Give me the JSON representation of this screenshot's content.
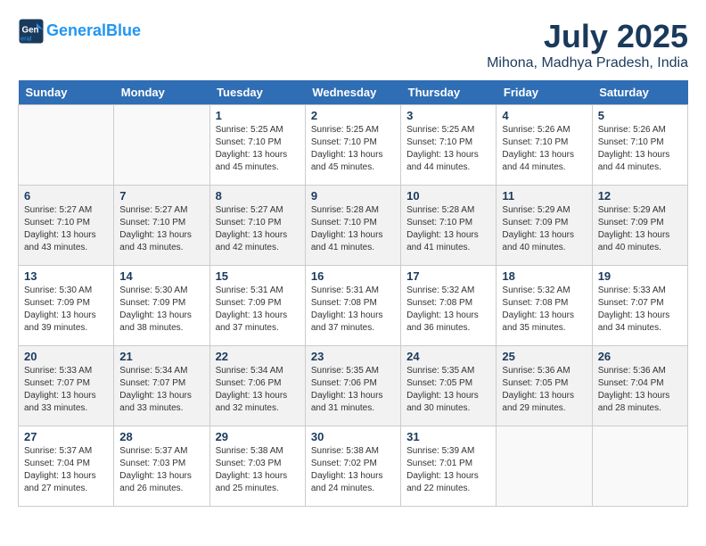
{
  "header": {
    "logo_line1": "General",
    "logo_line2": "Blue",
    "title": "July 2025",
    "location": "Mihona, Madhya Pradesh, India"
  },
  "days_of_week": [
    "Sunday",
    "Monday",
    "Tuesday",
    "Wednesday",
    "Thursday",
    "Friday",
    "Saturday"
  ],
  "weeks": [
    [
      {
        "day": "",
        "info": ""
      },
      {
        "day": "",
        "info": ""
      },
      {
        "day": "1",
        "info": "Sunrise: 5:25 AM\nSunset: 7:10 PM\nDaylight: 13 hours\nand 45 minutes."
      },
      {
        "day": "2",
        "info": "Sunrise: 5:25 AM\nSunset: 7:10 PM\nDaylight: 13 hours\nand 45 minutes."
      },
      {
        "day": "3",
        "info": "Sunrise: 5:25 AM\nSunset: 7:10 PM\nDaylight: 13 hours\nand 44 minutes."
      },
      {
        "day": "4",
        "info": "Sunrise: 5:26 AM\nSunset: 7:10 PM\nDaylight: 13 hours\nand 44 minutes."
      },
      {
        "day": "5",
        "info": "Sunrise: 5:26 AM\nSunset: 7:10 PM\nDaylight: 13 hours\nand 44 minutes."
      }
    ],
    [
      {
        "day": "6",
        "info": "Sunrise: 5:27 AM\nSunset: 7:10 PM\nDaylight: 13 hours\nand 43 minutes."
      },
      {
        "day": "7",
        "info": "Sunrise: 5:27 AM\nSunset: 7:10 PM\nDaylight: 13 hours\nand 43 minutes."
      },
      {
        "day": "8",
        "info": "Sunrise: 5:27 AM\nSunset: 7:10 PM\nDaylight: 13 hours\nand 42 minutes."
      },
      {
        "day": "9",
        "info": "Sunrise: 5:28 AM\nSunset: 7:10 PM\nDaylight: 13 hours\nand 41 minutes."
      },
      {
        "day": "10",
        "info": "Sunrise: 5:28 AM\nSunset: 7:10 PM\nDaylight: 13 hours\nand 41 minutes."
      },
      {
        "day": "11",
        "info": "Sunrise: 5:29 AM\nSunset: 7:09 PM\nDaylight: 13 hours\nand 40 minutes."
      },
      {
        "day": "12",
        "info": "Sunrise: 5:29 AM\nSunset: 7:09 PM\nDaylight: 13 hours\nand 40 minutes."
      }
    ],
    [
      {
        "day": "13",
        "info": "Sunrise: 5:30 AM\nSunset: 7:09 PM\nDaylight: 13 hours\nand 39 minutes."
      },
      {
        "day": "14",
        "info": "Sunrise: 5:30 AM\nSunset: 7:09 PM\nDaylight: 13 hours\nand 38 minutes."
      },
      {
        "day": "15",
        "info": "Sunrise: 5:31 AM\nSunset: 7:09 PM\nDaylight: 13 hours\nand 37 minutes."
      },
      {
        "day": "16",
        "info": "Sunrise: 5:31 AM\nSunset: 7:08 PM\nDaylight: 13 hours\nand 37 minutes."
      },
      {
        "day": "17",
        "info": "Sunrise: 5:32 AM\nSunset: 7:08 PM\nDaylight: 13 hours\nand 36 minutes."
      },
      {
        "day": "18",
        "info": "Sunrise: 5:32 AM\nSunset: 7:08 PM\nDaylight: 13 hours\nand 35 minutes."
      },
      {
        "day": "19",
        "info": "Sunrise: 5:33 AM\nSunset: 7:07 PM\nDaylight: 13 hours\nand 34 minutes."
      }
    ],
    [
      {
        "day": "20",
        "info": "Sunrise: 5:33 AM\nSunset: 7:07 PM\nDaylight: 13 hours\nand 33 minutes."
      },
      {
        "day": "21",
        "info": "Sunrise: 5:34 AM\nSunset: 7:07 PM\nDaylight: 13 hours\nand 33 minutes."
      },
      {
        "day": "22",
        "info": "Sunrise: 5:34 AM\nSunset: 7:06 PM\nDaylight: 13 hours\nand 32 minutes."
      },
      {
        "day": "23",
        "info": "Sunrise: 5:35 AM\nSunset: 7:06 PM\nDaylight: 13 hours\nand 31 minutes."
      },
      {
        "day": "24",
        "info": "Sunrise: 5:35 AM\nSunset: 7:05 PM\nDaylight: 13 hours\nand 30 minutes."
      },
      {
        "day": "25",
        "info": "Sunrise: 5:36 AM\nSunset: 7:05 PM\nDaylight: 13 hours\nand 29 minutes."
      },
      {
        "day": "26",
        "info": "Sunrise: 5:36 AM\nSunset: 7:04 PM\nDaylight: 13 hours\nand 28 minutes."
      }
    ],
    [
      {
        "day": "27",
        "info": "Sunrise: 5:37 AM\nSunset: 7:04 PM\nDaylight: 13 hours\nand 27 minutes."
      },
      {
        "day": "28",
        "info": "Sunrise: 5:37 AM\nSunset: 7:03 PM\nDaylight: 13 hours\nand 26 minutes."
      },
      {
        "day": "29",
        "info": "Sunrise: 5:38 AM\nSunset: 7:03 PM\nDaylight: 13 hours\nand 25 minutes."
      },
      {
        "day": "30",
        "info": "Sunrise: 5:38 AM\nSunset: 7:02 PM\nDaylight: 13 hours\nand 24 minutes."
      },
      {
        "day": "31",
        "info": "Sunrise: 5:39 AM\nSunset: 7:01 PM\nDaylight: 13 hours\nand 22 minutes."
      },
      {
        "day": "",
        "info": ""
      },
      {
        "day": "",
        "info": ""
      }
    ]
  ]
}
